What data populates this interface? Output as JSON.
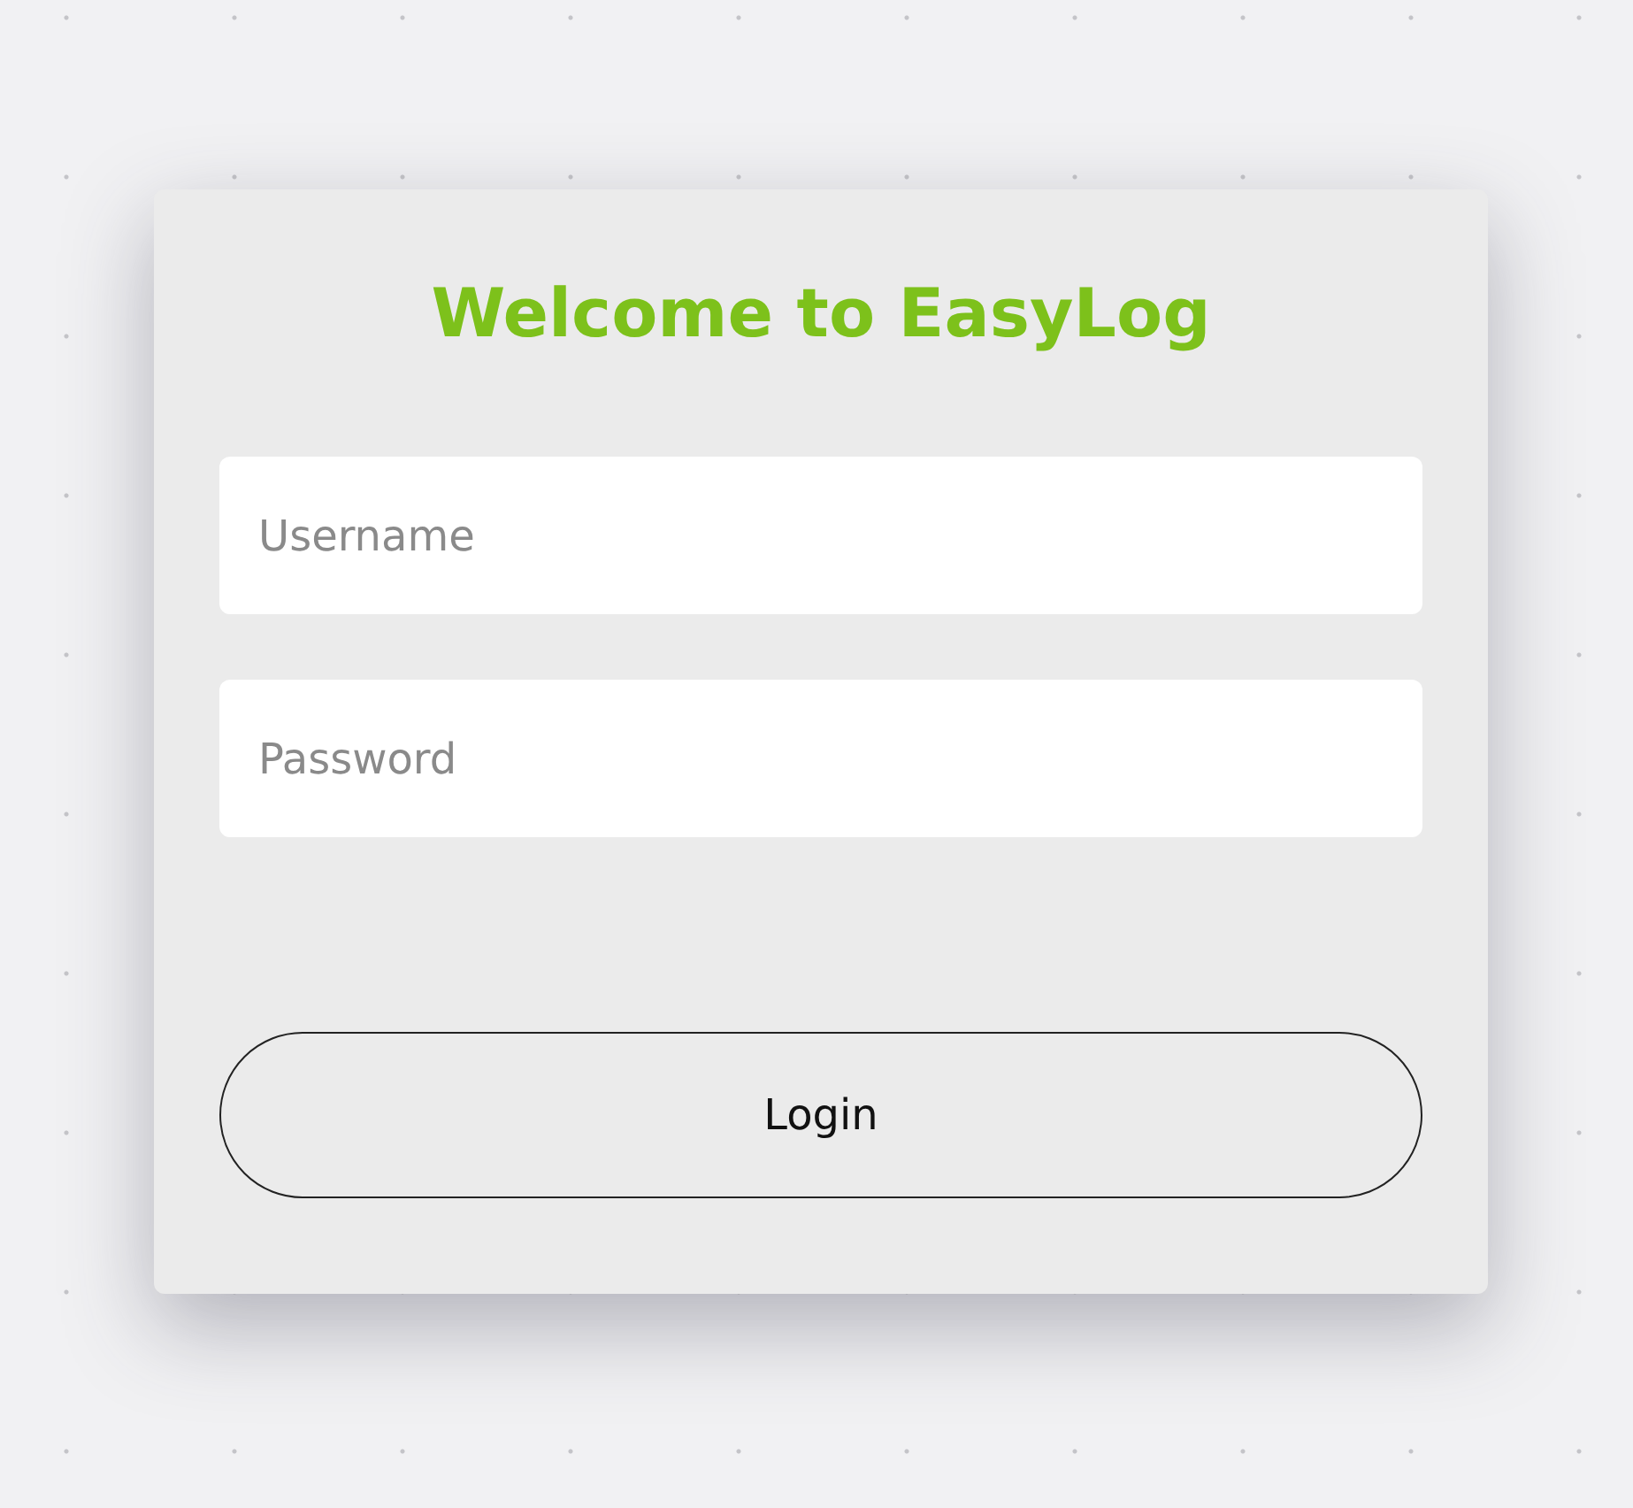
{
  "title": "Welcome to EasyLog",
  "fields": [
    {
      "placeholder": "Username"
    },
    {
      "placeholder": "Password"
    }
  ],
  "button": "Login"
}
